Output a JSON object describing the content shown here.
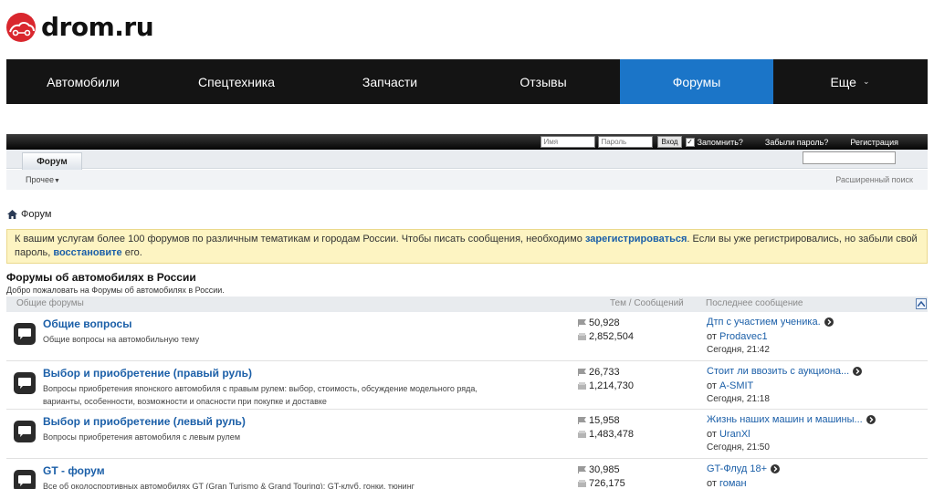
{
  "logo": {
    "text": "drom.ru",
    "accent": "#d9272e"
  },
  "topnav": {
    "items": [
      {
        "label": "Автомобили",
        "active": false
      },
      {
        "label": "Спецтехника",
        "active": false
      },
      {
        "label": "Запчасти",
        "active": false
      },
      {
        "label": "Отзывы",
        "active": false
      },
      {
        "label": "Форумы",
        "active": true
      },
      {
        "label": "Еще",
        "active": false
      }
    ],
    "active_color": "#1b75c8"
  },
  "loginbar": {
    "name_placeholder": "Имя",
    "password_placeholder": "Пароль",
    "login_button": "Вход",
    "remember_label": "Запомнить?",
    "remember_checked": true,
    "forgot_password": "Забыли пароль?",
    "register": "Регистрация"
  },
  "tabs": {
    "forum_tab": "Форум"
  },
  "subnav": {
    "other": "Прочее",
    "advanced_search": "Расширенный поиск"
  },
  "breadcrumb": {
    "home": "Форум"
  },
  "notice": {
    "part1": "К вашим услугам более 100 форумов по различным тематикам и городам России. Чтобы писать сообщения, необходимо ",
    "link_register": "зарегистрироваться",
    "part2": ". Если вы уже регистрировались, но забыли свой пароль, ",
    "link_restore": "восстановите",
    "part3": " его."
  },
  "section": {
    "title": "Форумы об автомобилях в России",
    "description": "Добро пожаловать на Форумы об автомобилях в России."
  },
  "columns": {
    "name": "Общие форумы",
    "stats": "Тем / Сообщений",
    "last": "Последнее сообщение"
  },
  "forums": [
    {
      "title": "Общие вопросы",
      "description": "Общие вопросы на автомобильную тему",
      "threads": "50,928",
      "posts": "2,852,504",
      "last_title": "Дтп с участием ученика.",
      "last_by_prefix": "от",
      "last_user": "Prodavec1",
      "last_date": "Сегодня, 21:42"
    },
    {
      "title": "Выбор и приобретение (правый руль)",
      "description": "Вопросы приобретения японского автомобиля с правым рулем: выбор, стоимость, обсуждение модельного ряда, варианты, особенности, возможности и опасности при покупке и доставке",
      "threads": "26,733",
      "posts": "1,214,730",
      "last_title": "Стоит ли ввозить с аукциона...",
      "last_by_prefix": "от",
      "last_user": "A-SMIT",
      "last_date": "Сегодня, 21:18"
    },
    {
      "title": "Выбор и приобретение (левый руль)",
      "description": "Вопросы приобретения автомобиля с левым рулем",
      "threads": "15,958",
      "posts": "1,483,478",
      "last_title": "Жизнь наших машин и машины...",
      "last_by_prefix": "от",
      "last_user": "UranXl",
      "last_date": "Сегодня, 21:50"
    },
    {
      "title": "GT - форум",
      "description": "Все об околоспортивных автомобилях GT (Gran Turismo & Grand Touring): GT-клуб, гонки, тюнинг",
      "threads": "30,985",
      "posts": "726,175",
      "last_title": "GT-Флуд 18+",
      "last_by_prefix": "от",
      "last_user": "гоман",
      "last_date": ""
    }
  ]
}
